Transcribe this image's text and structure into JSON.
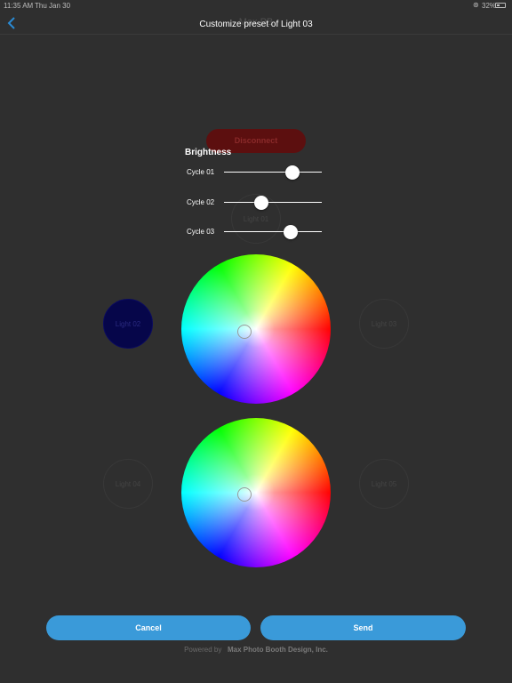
{
  "status_bar": {
    "time": "11:35 AM",
    "date": "Thu Jan 30",
    "wifi_icon": "wifi-icon",
    "battery": "32%"
  },
  "nav": {
    "back_icon": "chevron-left-icon",
    "background_title": "Max PB",
    "title": "Customize preset of Light 03"
  },
  "background": {
    "disconnect_label": "Disconnect",
    "lights": [
      {
        "label": "Light 01",
        "active": false
      },
      {
        "label": "Light 02",
        "active": true,
        "color": "#06064a"
      },
      {
        "label": "Light 03",
        "active": false
      },
      {
        "label": "Light 04",
        "active": false
      },
      {
        "label": "Light 05",
        "active": false
      }
    ]
  },
  "brightness": {
    "title": "Brightness",
    "sliders": [
      {
        "label": "Cycle 01",
        "value": 0.7
      },
      {
        "label": "Cycle 02",
        "value": 0.38
      },
      {
        "label": "Cycle 03",
        "value": 0.68
      }
    ]
  },
  "color_wheels": [
    {
      "name": "primary-color",
      "selected": "#ffffff"
    },
    {
      "name": "secondary-color",
      "selected": "#ffffff"
    }
  ],
  "actions": {
    "cancel_label": "Cancel",
    "send_label": "Send"
  },
  "footer": {
    "prefix": "Powered by",
    "brand": "Max Photo Booth Design, Inc."
  },
  "colors": {
    "background": "#2f2f2f",
    "accent": "#3a9ad9",
    "disconnect": "#5c0f0f"
  }
}
